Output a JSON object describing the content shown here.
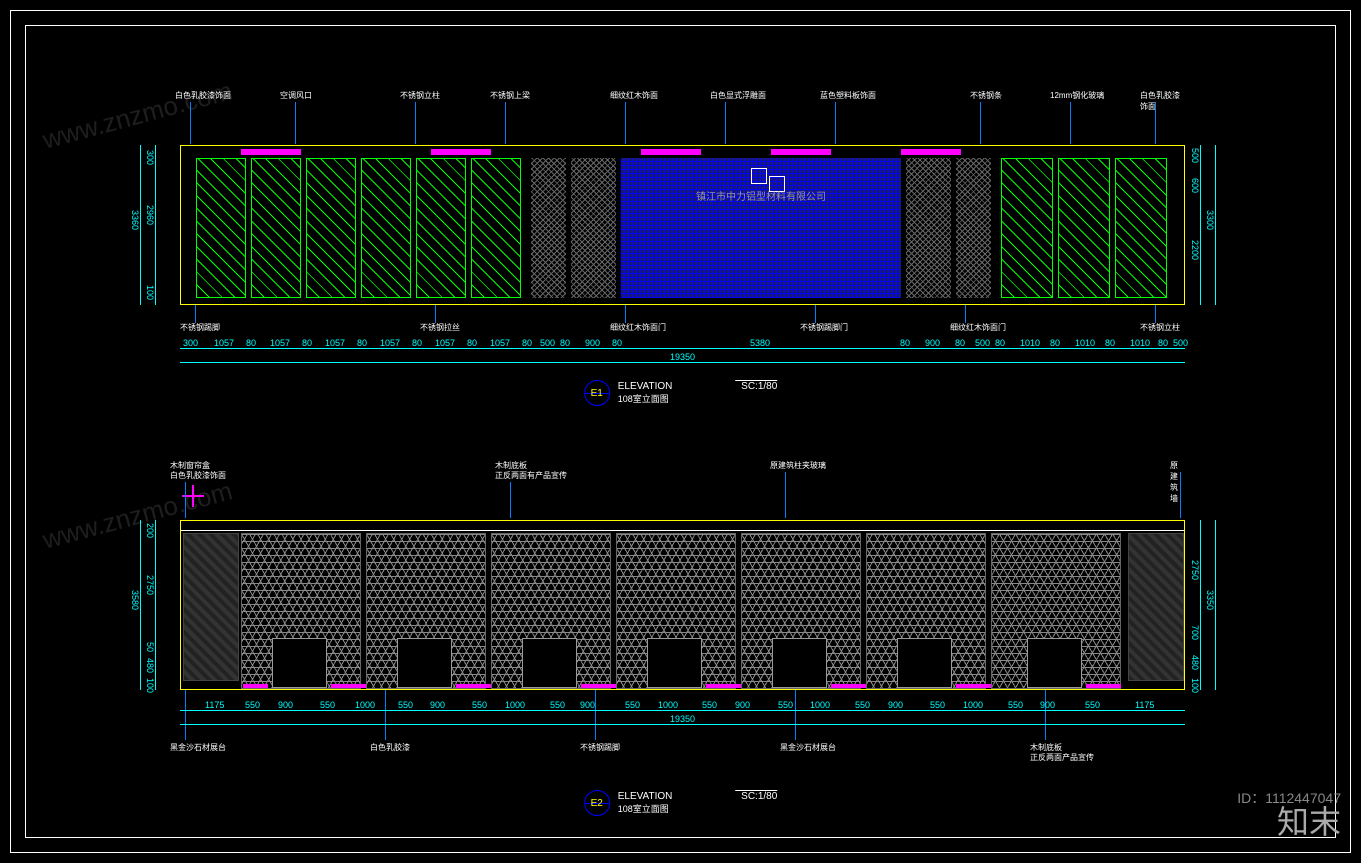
{
  "meta": {
    "id_label": "ID：1112447047",
    "brand": "知末",
    "watermark": "www.znzmo.com"
  },
  "company_text": "镇江市中力铝型材料有限公司",
  "elevation1": {
    "tag": "E1",
    "title": "ELEVATION",
    "subtitle": "108室立面图",
    "scale": "SC:1/80",
    "top_labels": [
      "白色乳胶漆饰面",
      "空调风口",
      "不锈钢立柱",
      "不锈钢上梁",
      "细纹红木饰面",
      "白色显式浮雕面",
      "蓝色塑料板饰面",
      "不锈钢条",
      "12mm钢化玻璃",
      "白色乳胶漆饰面"
    ],
    "bottom_labels": [
      "不锈钢踢脚",
      "不锈钢拉丝",
      "细纹红木饰面门",
      "不锈钢踢脚门",
      "细纹红木饰面门",
      "不锈钢立柱"
    ],
    "dims_h": [
      "300",
      "1057",
      "80",
      "1057",
      "80",
      "1057",
      "80",
      "1057",
      "80",
      "1057",
      "80",
      "1057",
      "80",
      "500",
      "80",
      "900",
      "80",
      "5380",
      "80",
      "900",
      "80",
      "500",
      "80",
      "1010",
      "80",
      "1010",
      "80",
      "1010",
      "80",
      "500"
    ],
    "dims_h_total": "19350",
    "dims_v_left": [
      "100",
      "2960",
      "300"
    ],
    "dims_v_left_total": "3360",
    "dims_v_right": [
      "500",
      "600",
      "2200"
    ],
    "dims_v_right_total": "3300"
  },
  "elevation2": {
    "tag": "E2",
    "title": "ELEVATION",
    "subtitle": "108室立面图",
    "scale": "SC:1/80",
    "top_labels": [
      "木制窗帘盒",
      "白色乳胶漆饰面",
      "木制底板",
      "正反两面有产品宣传",
      "原建筑柱夹玻璃",
      "原建筑墙"
    ],
    "bottom_labels": [
      "黑金沙石材展台",
      "白色乳胶漆",
      "不锈钢踢脚",
      "黑金沙石材展台",
      "木制底板",
      "正反两面产品宣传"
    ],
    "dims_h": [
      "1175",
      "550",
      "900",
      "550",
      "1000",
      "550",
      "900",
      "550",
      "1000",
      "550",
      "900",
      "550",
      "1000",
      "550",
      "900",
      "550",
      "1000",
      "550",
      "900",
      "550",
      "1000",
      "550",
      "900",
      "550",
      "1175"
    ],
    "dims_h_total": "19350",
    "dims_v_left": [
      "100",
      "480",
      "50",
      "2750",
      "200"
    ],
    "dims_v_left_total": "3580",
    "dims_v_right": [
      "100",
      "480",
      "700",
      "2750"
    ],
    "dims_v_right_total": "3350"
  }
}
